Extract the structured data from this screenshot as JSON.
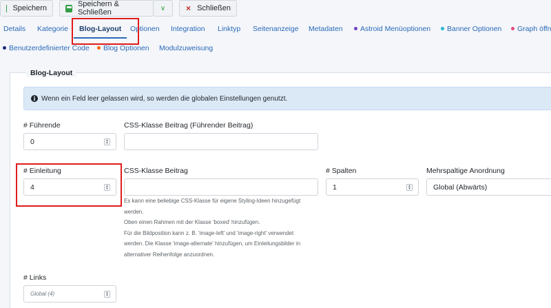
{
  "toolbar": {
    "save": "Speichern",
    "save_close": "Speichern & Schließen",
    "close": "Schließen"
  },
  "tabs_row1": [
    {
      "label": "Details"
    },
    {
      "label": "Kategorie"
    },
    {
      "label": "Blog-Layout"
    },
    {
      "label": "Optionen"
    },
    {
      "label": "Integration"
    },
    {
      "label": "Linktyp"
    },
    {
      "label": "Seitenanzeige"
    },
    {
      "label": "Metadaten"
    },
    {
      "label": "Astroid Menüoptionen",
      "dot": "#6f42c1"
    },
    {
      "label": "Banner Optionen",
      "dot": "#22b8cf"
    },
    {
      "label": "Graph öffne",
      "dot": "#e64980"
    }
  ],
  "tabs_row2": [
    {
      "label": "Benutzerdefinierter Code",
      "dot": "#1c2a7a"
    },
    {
      "label": "Blog Optionen",
      "dot": "#f76707"
    },
    {
      "label": "Modulzuweisung"
    }
  ],
  "section": {
    "legend": "Blog-Layout",
    "alert": "Wenn ein Feld leer gelassen wird, so werden die globalen Einstellungen genutzt."
  },
  "fields": {
    "leading_label": "# Führende",
    "leading_value": "0",
    "leading_css_label": "CSS-Klasse Beitrag (Führender Beitrag)",
    "intro_label": "# Einleitung",
    "intro_value": "4",
    "intro_css_label": "CSS-Klasse Beitrag",
    "columns_label": "# Spalten",
    "columns_value": "1",
    "multicolumn_label": "Mehrspaltige Anordnung",
    "multicolumn_value": "Global (Abwärts)",
    "links_label": "# Links",
    "links_placeholder": "Global (4)"
  },
  "help_lines": [
    "Es kann eine beliebige CSS-Klasse für eigene Styling-Ideen hinzugefügt",
    "werden.",
    "Oben einen Rahmen mit der Klasse 'boxed' hinzufügen.",
    "Für die Bildposition kann z. B. 'image-left' und 'image-right' verwendet",
    "werden. Die Klasse 'image-alternate' hinzufügen, um Einleitungsbilder in",
    "alternativer Reihenfolge anzuordnen."
  ],
  "colors": {
    "accent": "#2a69b8",
    "highlight": "#e01b1b",
    "save_green": "#2f9e44",
    "close_red": "#c92a2a"
  },
  "icons": {
    "save": "save-icon",
    "dropdown": "chevron-down-icon",
    "close": "close-icon",
    "info": "info-icon"
  }
}
